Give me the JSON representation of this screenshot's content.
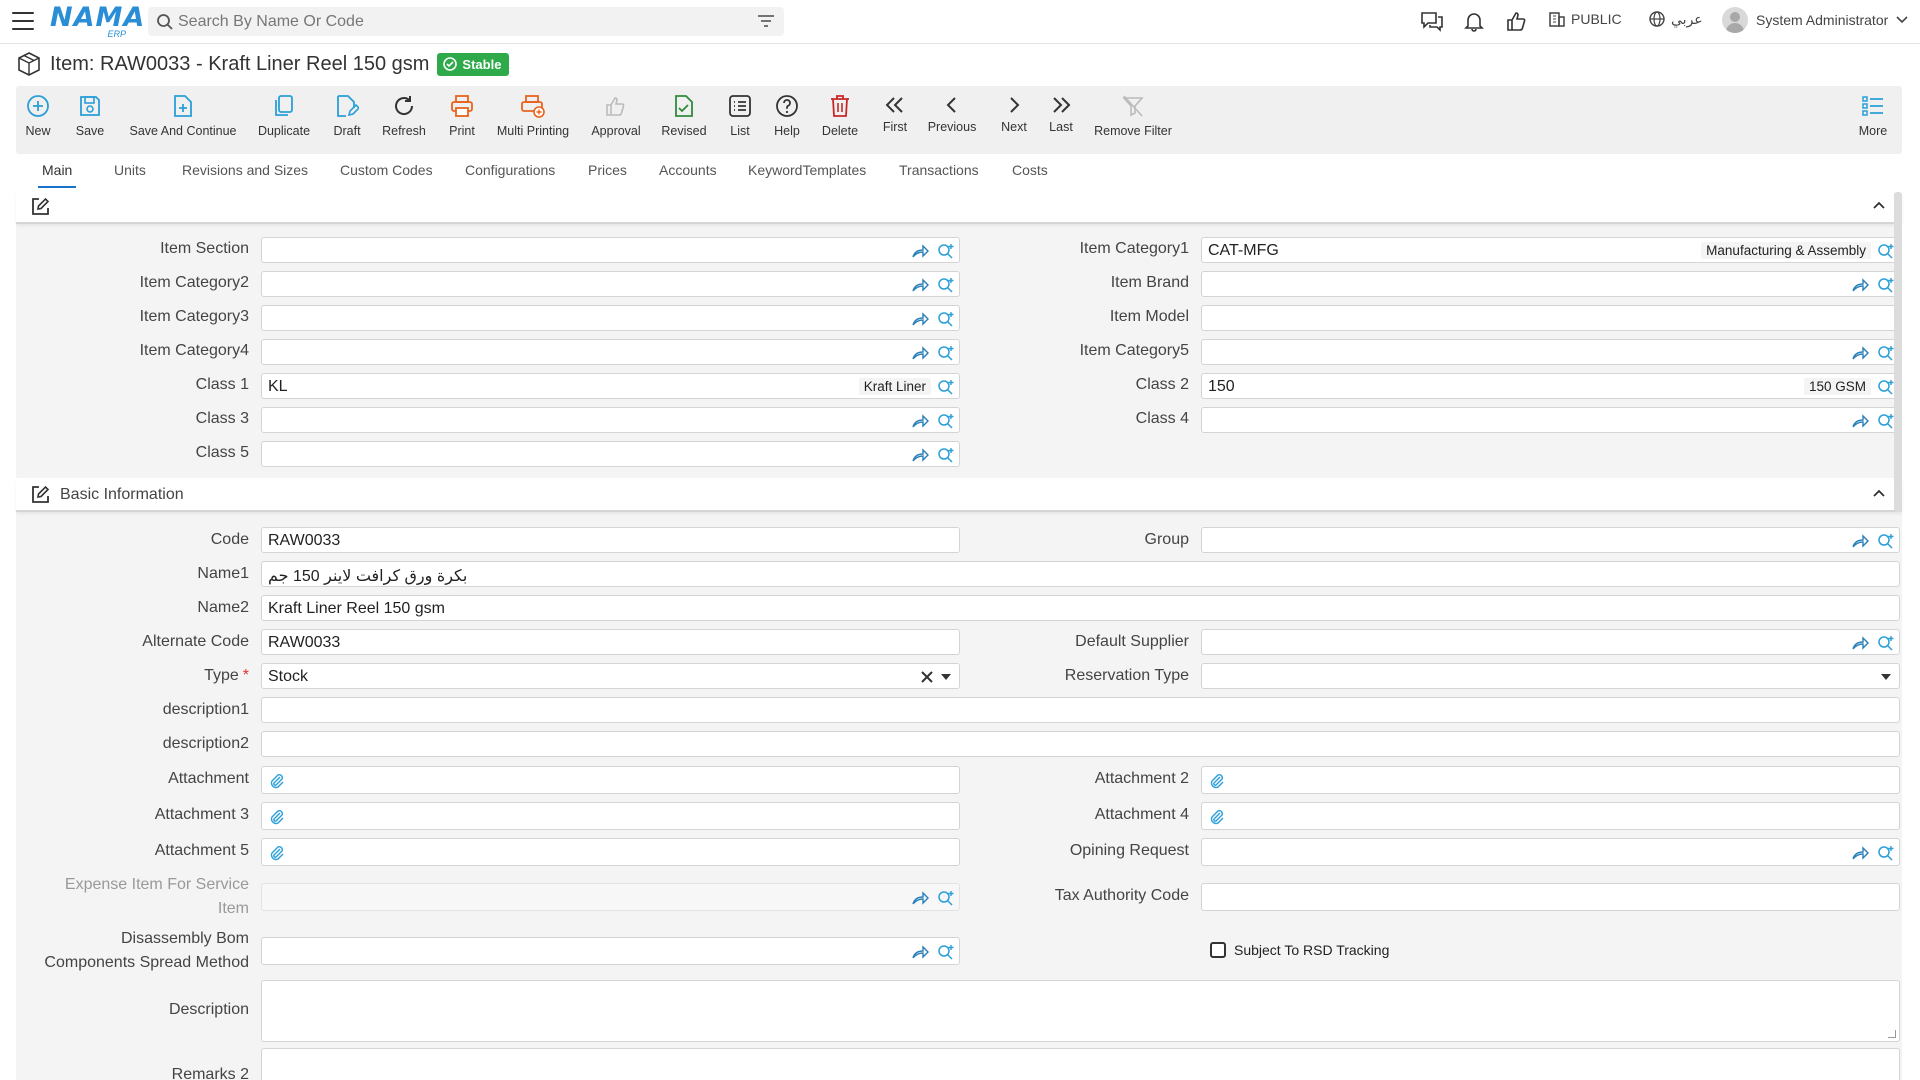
{
  "app": {
    "logo_text": "NAMA",
    "logo_sub": "ERP"
  },
  "search": {
    "placeholder": "Search By Name Or Code"
  },
  "topbar": {
    "company": "PUBLIC",
    "language": "عربي",
    "user": "System Administrator"
  },
  "page": {
    "title": "Item: RAW0033 - Kraft Liner Reel 150 gsm",
    "status": "Stable"
  },
  "toolbar": {
    "new": "New",
    "save": "Save",
    "save_continue": "Save And Continue",
    "duplicate": "Duplicate",
    "draft": "Draft",
    "refresh": "Refresh",
    "print": "Print",
    "multi_printing": "Multi Printing",
    "approval": "Approval",
    "revised": "Revised",
    "list": "List",
    "help": "Help",
    "delete": "Delete",
    "first": "First",
    "previous": "Previous",
    "next": "Next",
    "last": "Last",
    "remove_filter": "Remove Filter",
    "more": "More"
  },
  "tabs": [
    "Main",
    "Units",
    "Revisions and Sizes",
    "Custom Codes",
    "Configurations",
    "Prices",
    "Accounts",
    "KeywordTemplates",
    "Transactions",
    "Costs"
  ],
  "section1": {
    "title": "",
    "item_section": "Item Section",
    "item_category1": "Item Category1",
    "item_category1_value": "CAT-MFG",
    "item_category1_tag": "Manufacturing & Assembly",
    "item_category2": "Item Category2",
    "item_brand": "Item Brand",
    "item_category3": "Item Category3",
    "item_model": "Item Model",
    "item_category4": "Item Category4",
    "item_category5": "Item Category5",
    "class1": "Class 1",
    "class1_value": "KL",
    "class1_tag": "Kraft Liner",
    "class2": "Class 2",
    "class2_value": "150",
    "class2_tag": "150 GSM",
    "class3": "Class 3",
    "class4": "Class 4",
    "class5": "Class 5"
  },
  "section2": {
    "title": "Basic Information",
    "code": "Code",
    "code_value": "RAW0033",
    "group": "Group",
    "name1": "Name1",
    "name1_value": "بكرة ورق كرافت لاينر 150 جم",
    "name2": "Name2",
    "name2_value": "Kraft Liner Reel 150 gsm",
    "alternate_code": "Alternate Code",
    "alternate_code_value": "RAW0033",
    "default_supplier": "Default Supplier",
    "type": "Type",
    "type_required": "*",
    "type_value": "Stock",
    "reservation_type": "Reservation Type",
    "description1": "description1",
    "description2": "description2",
    "attachment": "Attachment",
    "attachment2": "Attachment 2",
    "attachment3": "Attachment 3",
    "attachment4": "Attachment 4",
    "attachment5": "Attachment 5",
    "opining_request": "Opining Request",
    "expense_item": "Expense Item For Service Item",
    "tax_authority_code": "Tax Authority Code",
    "disassembly": "Disassembly Bom Components Spread Method",
    "subject_rsd": "Subject To RSD Tracking",
    "description": "Description",
    "remarks_partial": "Remarks 2"
  },
  "colors": {
    "accent": "#1a73c9",
    "stable_badge": "#2eaa4a",
    "icon_teal": "#2a9fd8",
    "print_orange": "#e8631e",
    "delete_red": "#c62828",
    "revised_green": "#2e8b3e"
  }
}
